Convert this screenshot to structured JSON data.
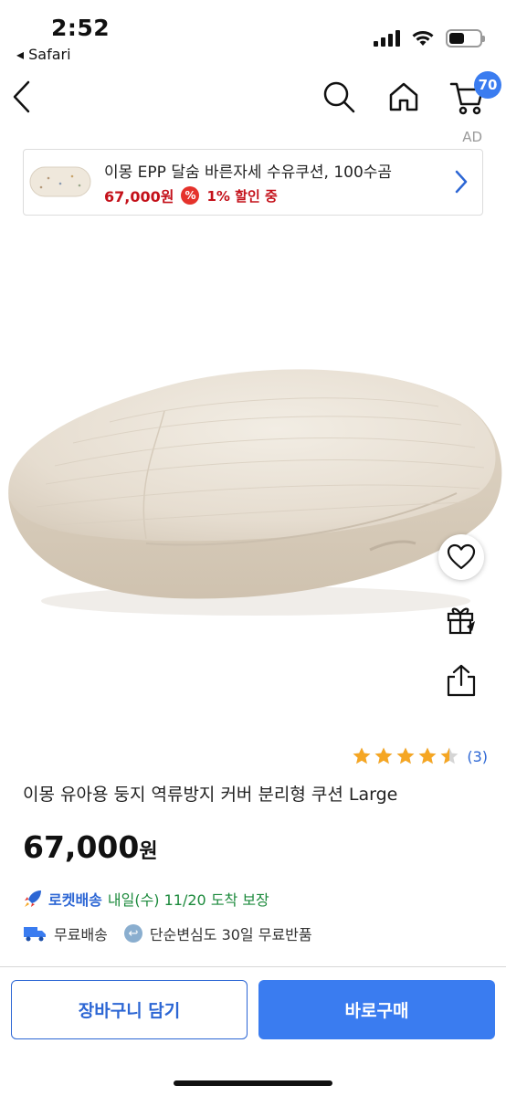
{
  "status_bar": {
    "time": "2:52",
    "back_app": "◂ Safari"
  },
  "nav": {
    "cart_count": "70",
    "ad_label": "AD"
  },
  "ad_banner": {
    "title": "이몽 EPP 달숨 바른자세 수유쿠션, 100수곰",
    "price": "67,000원",
    "discount_icon": "%",
    "discount": "1% 할인 중"
  },
  "product": {
    "rating": 4.5,
    "review_count": "(3)",
    "title": "이몽 유아용 둥지 역류방지 커버 분리형 쿠션 Large",
    "price_number": "67,000",
    "price_unit": "원"
  },
  "delivery": {
    "rocket_label": "로켓배송",
    "delivery_info": "내일(수) 11/20 도착 보장",
    "free_shipping": "무료배송",
    "free_returns": "단순변심도 30일 무료반품"
  },
  "buttons": {
    "add_to_cart": "장바구니 담기",
    "buy_now": "바로구매"
  },
  "colors": {
    "accent_blue": "#3a7cf0",
    "link_blue": "#2c66d4",
    "price_red": "#c4111a",
    "delivery_green": "#1c8a3c",
    "star_yellow": "#f5a623"
  },
  "icons": [
    "back-icon",
    "search-icon",
    "home-icon",
    "cart-icon",
    "heart-icon",
    "gift-icon",
    "share-icon",
    "chevron-right-icon",
    "rocket-icon",
    "truck-icon",
    "return-icon"
  ]
}
